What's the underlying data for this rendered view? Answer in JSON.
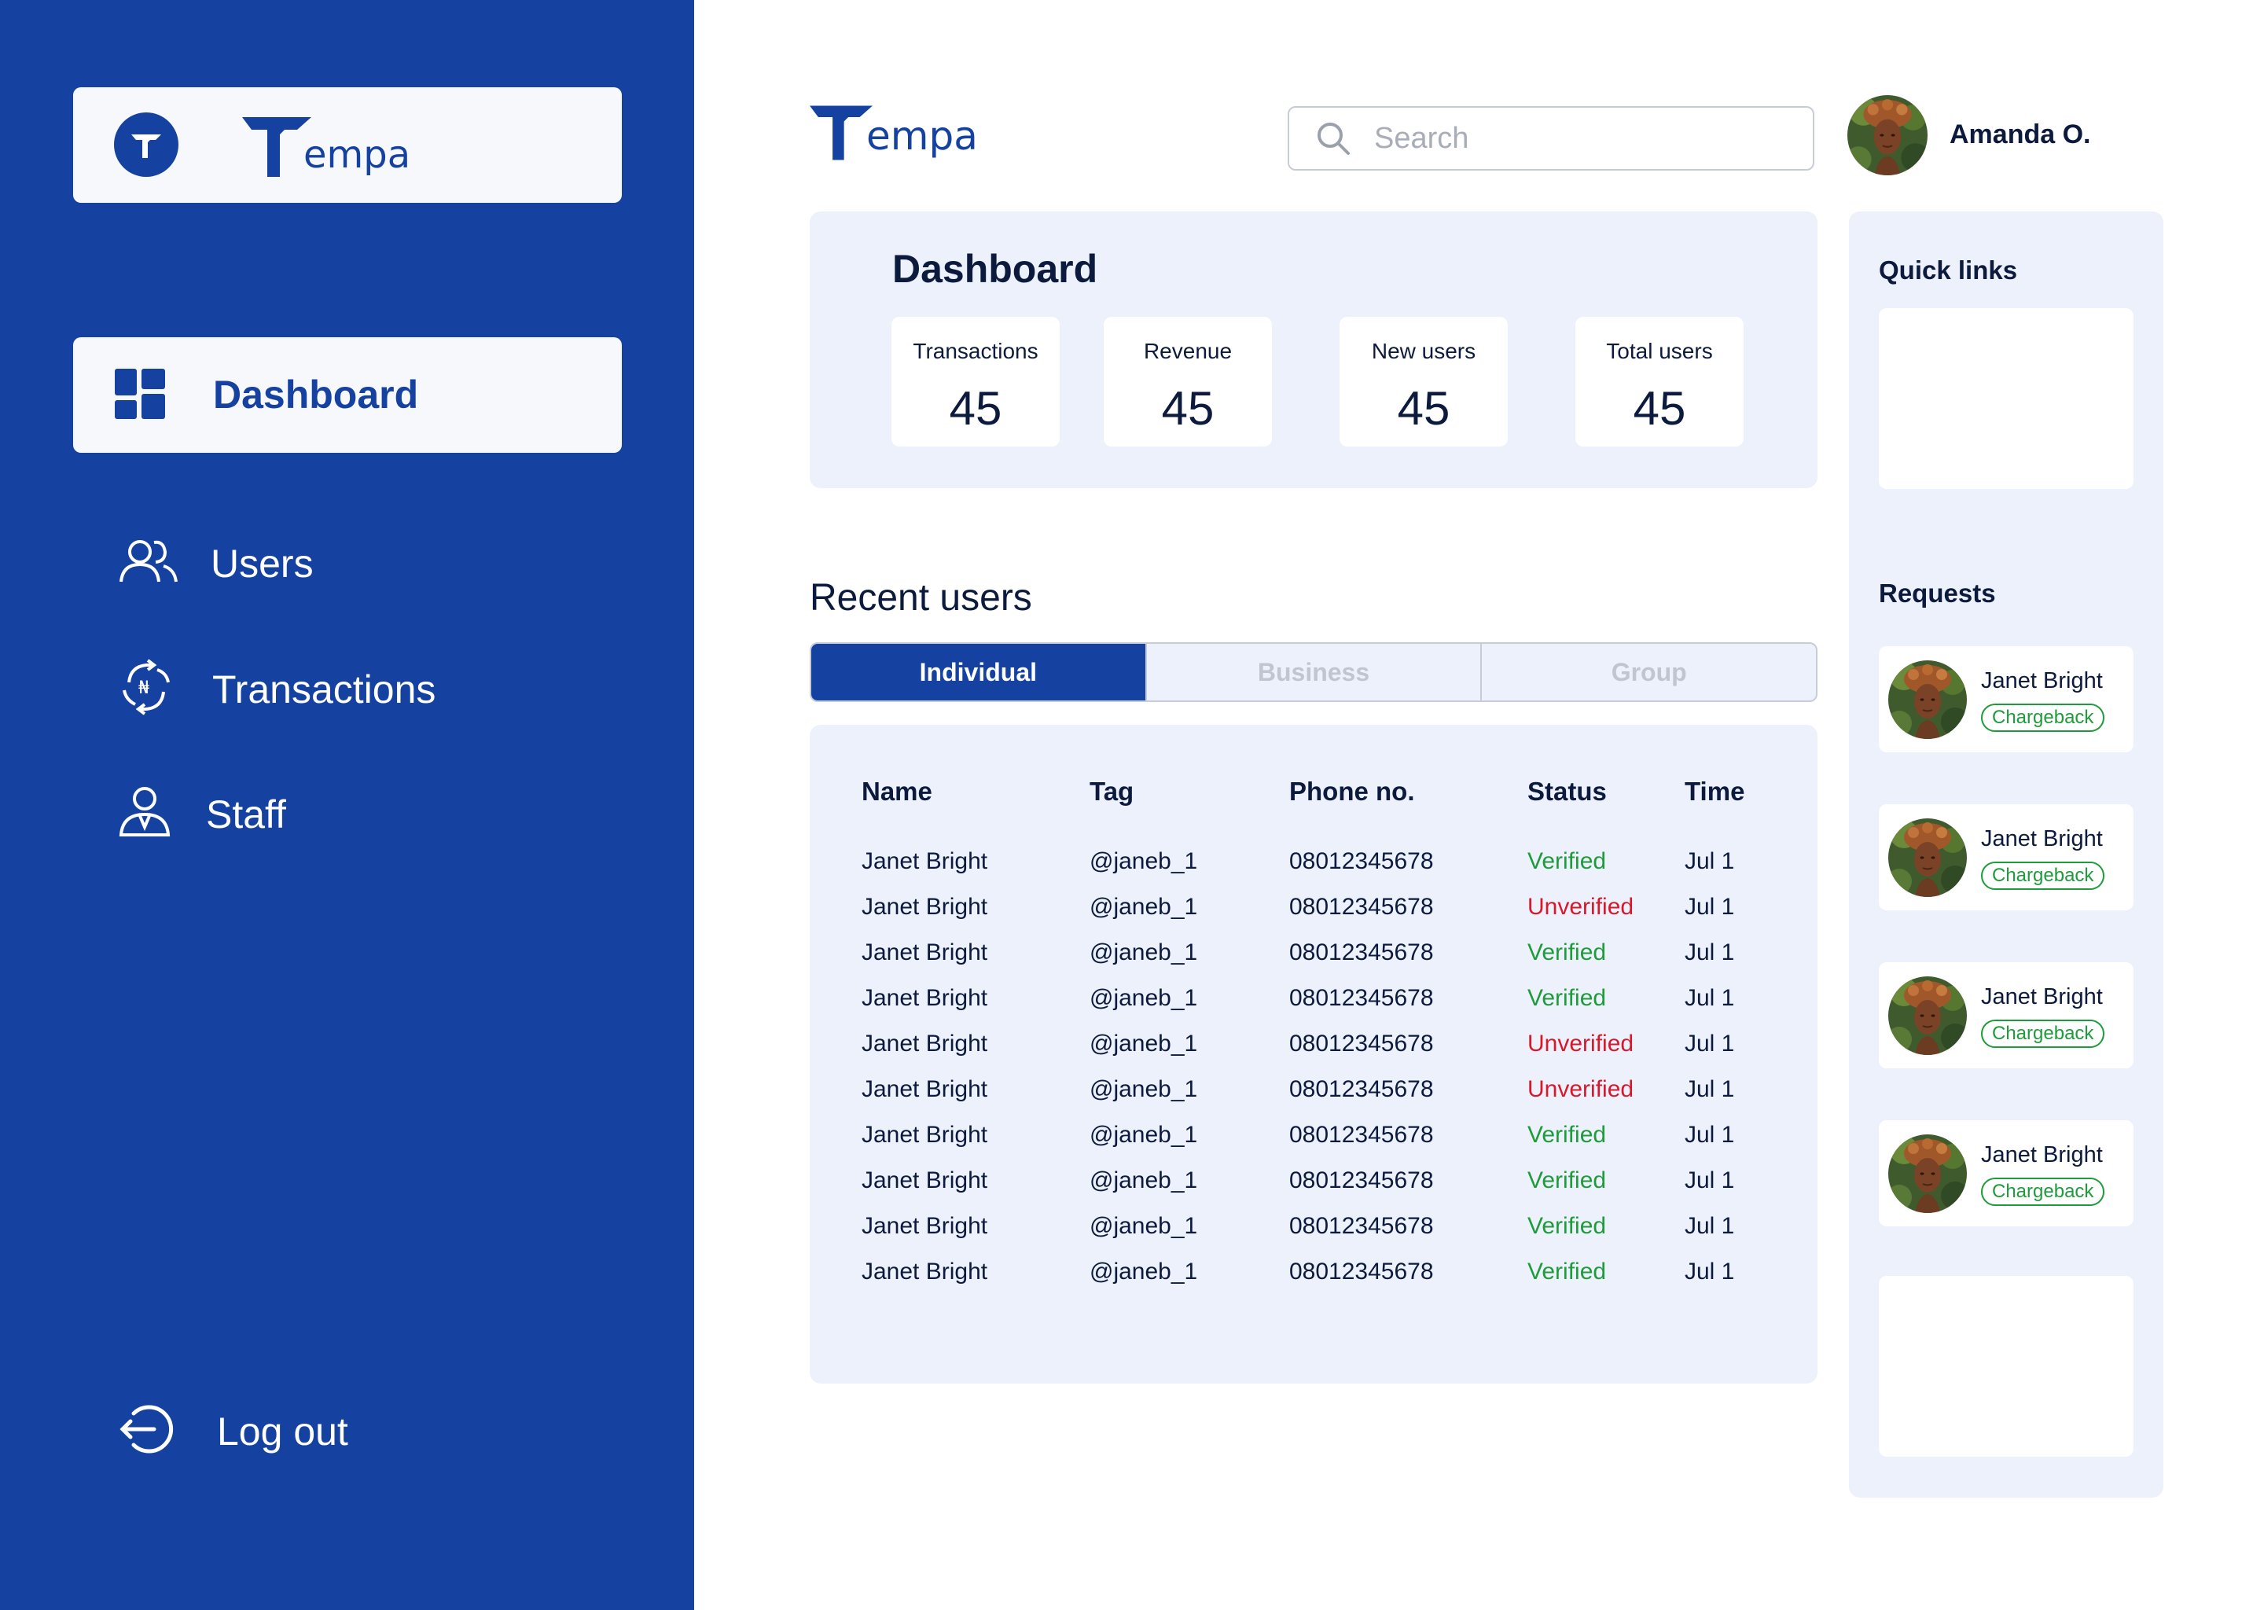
{
  "brand": {
    "name": "empa",
    "color": "#1541a0"
  },
  "sidebar": {
    "background": "#1541a0",
    "active_item": {
      "label": "Dashboard",
      "icon": "dashboard-grid-icon"
    },
    "items": [
      {
        "label": "Users",
        "icon": "users-icon"
      },
      {
        "label": "Transactions",
        "icon": "transactions-icon"
      },
      {
        "label": "Staff",
        "icon": "staff-icon"
      }
    ],
    "logout": {
      "label": "Log out",
      "icon": "logout-icon"
    }
  },
  "header": {
    "search": {
      "placeholder": "Search",
      "value": "",
      "icon": "search-icon"
    },
    "user": {
      "name": "Amanda O."
    }
  },
  "dashboard": {
    "title": "Dashboard",
    "stats": [
      {
        "label": "Transactions",
        "value": "45"
      },
      {
        "label": "Revenue",
        "value": "45"
      },
      {
        "label": "New users",
        "value": "45"
      },
      {
        "label": "Total users",
        "value": "45"
      }
    ]
  },
  "recent_users": {
    "title": "Recent users",
    "tabs": [
      {
        "label": "Individual",
        "active": true
      },
      {
        "label": "Business",
        "active": false
      },
      {
        "label": "Group",
        "active": false
      }
    ],
    "columns": [
      "Name",
      "Tag",
      "Phone no.",
      "Status",
      "Time"
    ],
    "rows": [
      {
        "name": "Janet Bright",
        "tag": "@janeb_1",
        "phone": "08012345678",
        "status": "Verified",
        "time": "Jul 1"
      },
      {
        "name": "Janet Bright",
        "tag": "@janeb_1",
        "phone": "08012345678",
        "status": "Unverified",
        "time": "Jul 1"
      },
      {
        "name": "Janet Bright",
        "tag": "@janeb_1",
        "phone": "08012345678",
        "status": "Verified",
        "time": "Jul 1"
      },
      {
        "name": "Janet Bright",
        "tag": "@janeb_1",
        "phone": "08012345678",
        "status": "Verified",
        "time": "Jul 1"
      },
      {
        "name": "Janet Bright",
        "tag": "@janeb_1",
        "phone": "08012345678",
        "status": "Unverified",
        "time": "Jul 1"
      },
      {
        "name": "Janet Bright",
        "tag": "@janeb_1",
        "phone": "08012345678",
        "status": "Unverified",
        "time": "Jul 1"
      },
      {
        "name": "Janet Bright",
        "tag": "@janeb_1",
        "phone": "08012345678",
        "status": "Verified",
        "time": "Jul 1"
      },
      {
        "name": "Janet Bright",
        "tag": "@janeb_1",
        "phone": "08012345678",
        "status": "Verified",
        "time": "Jul 1"
      },
      {
        "name": "Janet Bright",
        "tag": "@janeb_1",
        "phone": "08012345678",
        "status": "Verified",
        "time": "Jul 1"
      },
      {
        "name": "Janet Bright",
        "tag": "@janeb_1",
        "phone": "08012345678",
        "status": "Verified",
        "time": "Jul 1"
      }
    ],
    "status_colors": {
      "Verified": "#1e9b3a",
      "Unverified": "#d7192b"
    }
  },
  "right_panel": {
    "quick_links_title": "Quick links",
    "requests_title": "Requests",
    "requests": [
      {
        "name": "Janet Bright",
        "badge": "Chargeback"
      },
      {
        "name": "Janet Bright",
        "badge": "Chargeback"
      },
      {
        "name": "Janet Bright",
        "badge": "Chargeback"
      },
      {
        "name": "Janet Bright",
        "badge": "Chargeback"
      }
    ]
  }
}
